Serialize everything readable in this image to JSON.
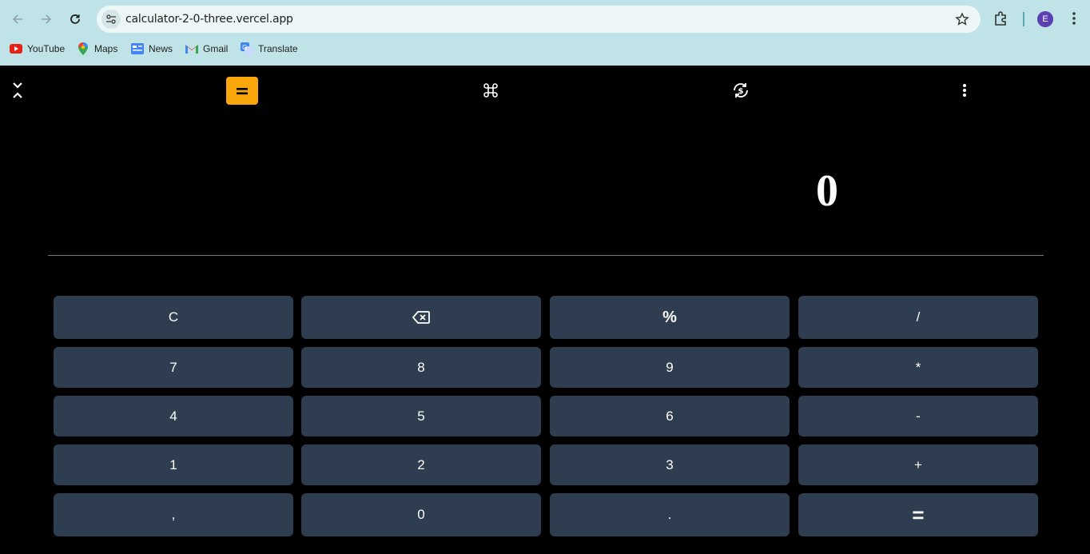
{
  "browser": {
    "url": "calculator-2-0-three.vercel.app",
    "profile_initial": "E",
    "bookmarks": [
      {
        "label": "YouTube",
        "icon": "youtube-icon"
      },
      {
        "label": "Maps",
        "icon": "maps-icon"
      },
      {
        "label": "News",
        "icon": "news-icon"
      },
      {
        "label": "Gmail",
        "icon": "gmail-icon"
      },
      {
        "label": "Translate",
        "icon": "translate-icon"
      }
    ]
  },
  "calculator": {
    "display_value": "0",
    "accent_color": "#f9a70b",
    "key_color": "#2e3d4f",
    "keys": {
      "clear": "C",
      "backspace": "backspace-icon",
      "percent": "%",
      "divide": "/",
      "seven": "7",
      "eight": "8",
      "nine": "9",
      "multiply": "*",
      "four": "4",
      "five": "5",
      "six": "6",
      "minus": "-",
      "one": "1",
      "two": "2",
      "three": "3",
      "plus": "+",
      "comma": ",",
      "zero": "0",
      "dot": ".",
      "equals": "="
    }
  }
}
